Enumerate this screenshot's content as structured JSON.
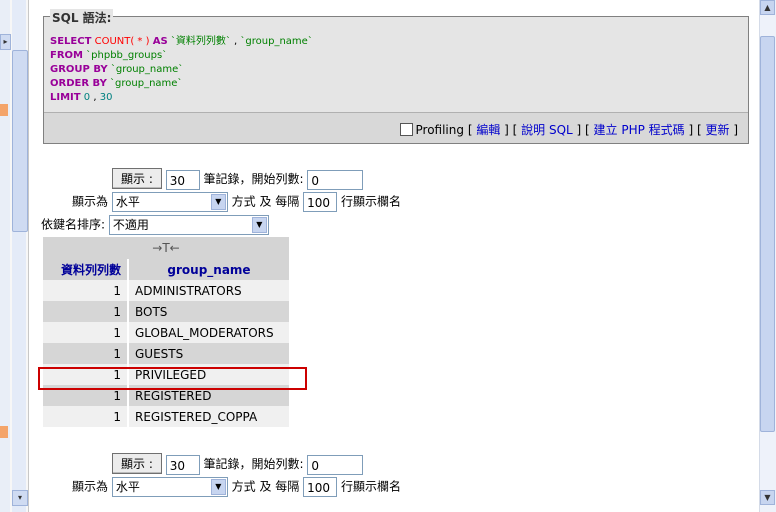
{
  "sql": {
    "legend": "SQL 語法:",
    "lines": {
      "l1": {
        "kw1": "SELECT",
        "fn": "COUNT( * )",
        "kw2": "AS",
        "str1": "`資料列列數`",
        "comma": ",",
        "str2": "`group_name`"
      },
      "l2": {
        "kw": "FROM",
        "str": "`phpbb_groups`"
      },
      "l3": {
        "kw": "GROUP BY",
        "str": "`group_name`"
      },
      "l4": {
        "kw": "ORDER BY",
        "str": "`group_name`"
      },
      "l5": {
        "kw": "LIMIT",
        "n1": "0",
        "comma": ",",
        "n2": "30"
      }
    },
    "toolbar": {
      "profiling": "Profiling",
      "edit": "編輯",
      "explain": "說明 SQL",
      "create_php": "建立 PHP 程式碼",
      "refresh": "更新"
    }
  },
  "nav_top": {
    "show_button": "顯示 :",
    "rows_value": "30",
    "records_label": "筆記錄，開始列數:",
    "start_value": "0",
    "display_as_label": "顯示為",
    "mode_value": "水平",
    "mode_suffix": "方式 及 每隔",
    "repeat_value": "100",
    "repeat_suffix": "行顯示欄名"
  },
  "sort": {
    "label": "依鍵名排序:",
    "value": "不適用"
  },
  "table": {
    "sort_tool": "→T←",
    "columns": [
      "資料列列數",
      "group_name"
    ],
    "rows": [
      {
        "count": "1",
        "name": "ADMINISTRATORS"
      },
      {
        "count": "1",
        "name": "BOTS"
      },
      {
        "count": "1",
        "name": "GLOBAL_MODERATORS"
      },
      {
        "count": "1",
        "name": "GUESTS"
      },
      {
        "count": "1",
        "name": "PRIVILEGED"
      },
      {
        "count": "1",
        "name": "REGISTERED"
      },
      {
        "count": "1",
        "name": "REGISTERED_COPPA"
      }
    ]
  },
  "nav_bottom": {
    "show_button": "顯示 :",
    "rows_value": "30",
    "records_label": "筆記錄，開始列數:",
    "start_value": "0",
    "display_as_label": "顯示為",
    "mode_value": "水平",
    "mode_suffix": "方式 及 每隔",
    "repeat_value": "100",
    "repeat_suffix": "行顯示欄名"
  },
  "colors": {
    "highlight": "#cc0000",
    "keyword": "#990099",
    "link": "#0000cc",
    "header_text": "#000099"
  }
}
